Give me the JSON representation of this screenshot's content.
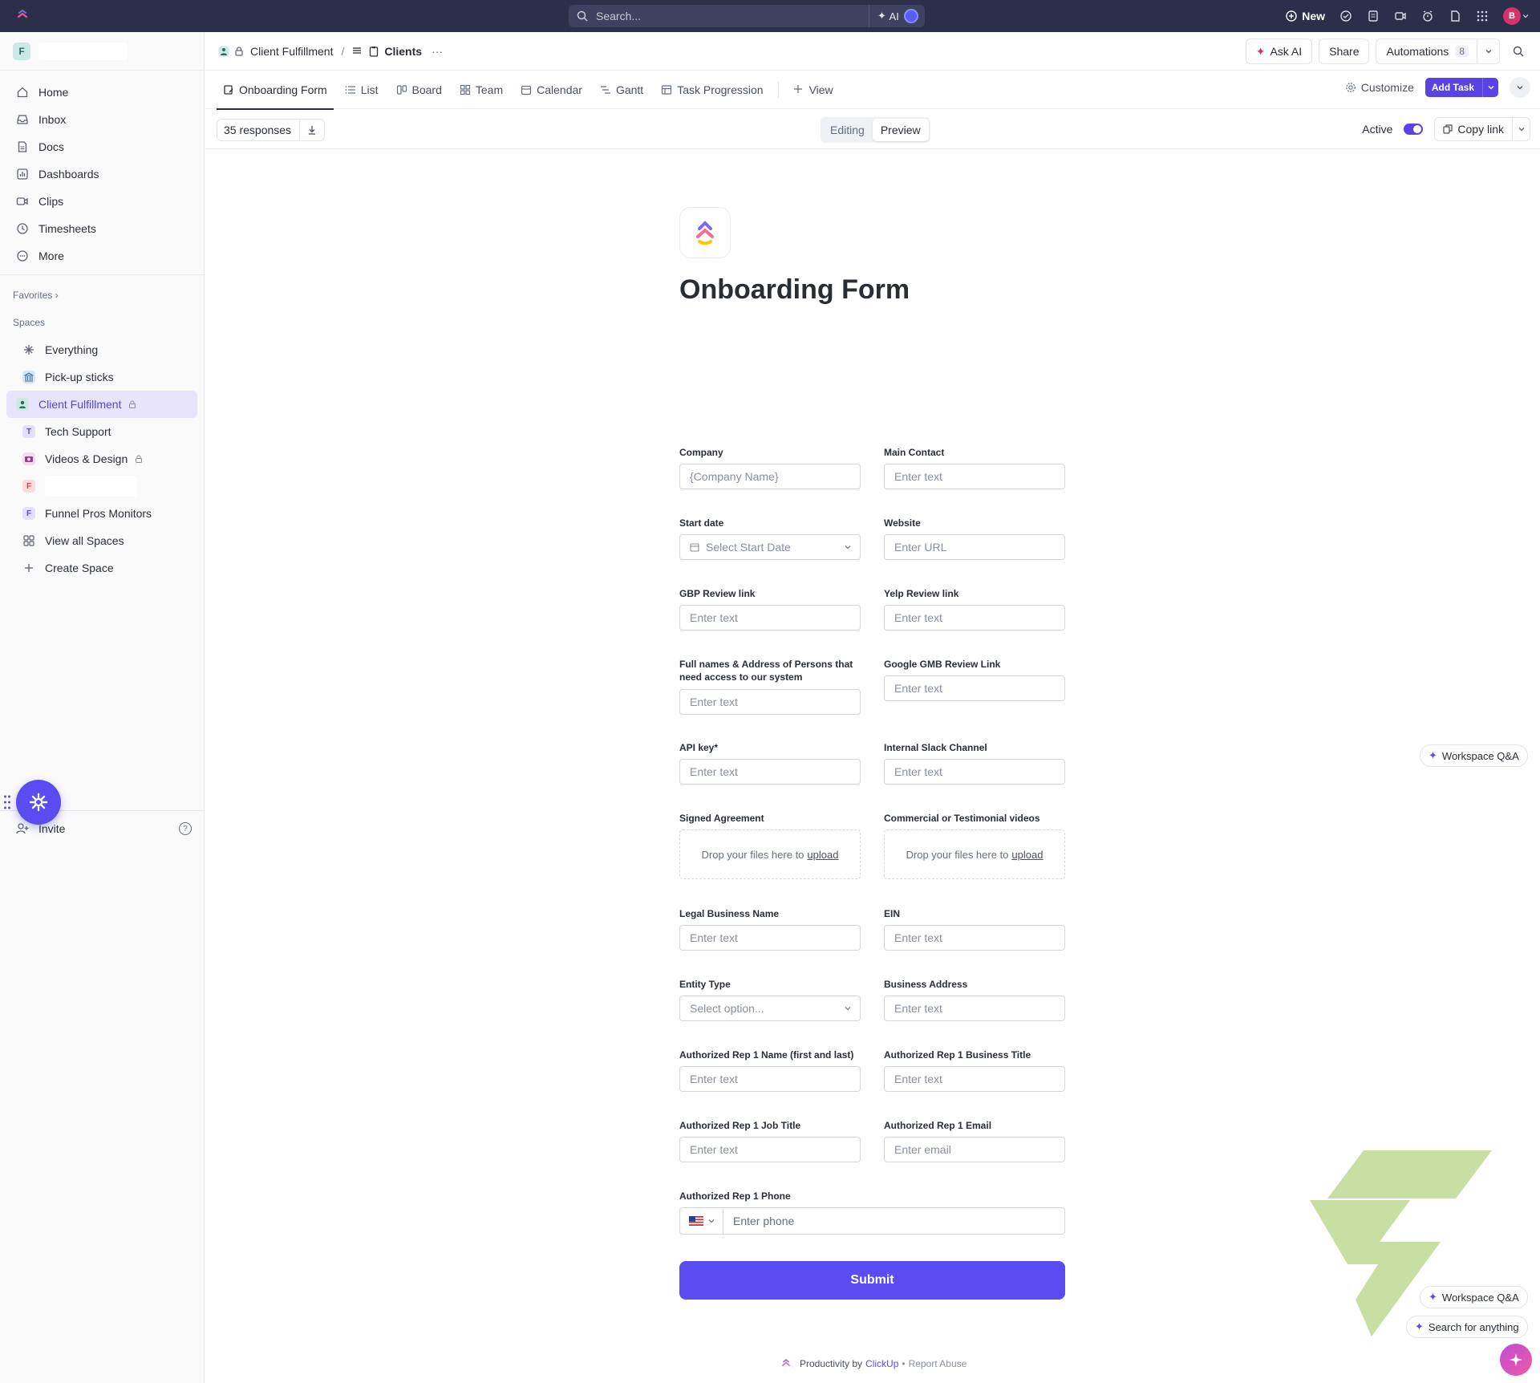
{
  "topbar": {
    "search_placeholder": "Search...",
    "ai_label": "AI",
    "new_label": "New",
    "avatar_initial": "B"
  },
  "sidebar": {
    "workspace_initial": "F",
    "nav": [
      {
        "label": "Home",
        "icon": "home-icon"
      },
      {
        "label": "Inbox",
        "icon": "inbox-icon"
      },
      {
        "label": "Docs",
        "icon": "docs-icon"
      },
      {
        "label": "Dashboards",
        "icon": "dashboards-icon"
      },
      {
        "label": "Clips",
        "icon": "clips-icon"
      },
      {
        "label": "Timesheets",
        "icon": "timesheets-icon"
      },
      {
        "label": "More",
        "icon": "more-icon"
      }
    ],
    "favorites_label": "Favorites",
    "spaces_label": "Spaces",
    "spaces": [
      {
        "label": "Everything",
        "icon": "everything-icon"
      },
      {
        "label": "Pick-up sticks",
        "icon": "bank-icon"
      },
      {
        "label": "Client Fulfillment",
        "icon": "person-icon",
        "locked": true,
        "active": true
      },
      {
        "label": "Tech Support",
        "badge": "T"
      },
      {
        "label": "Videos & Design",
        "icon": "camera-icon",
        "locked": true
      },
      {
        "label": "",
        "badge": "F"
      },
      {
        "label": "Funnel Pros Monitors",
        "badge": "F"
      },
      {
        "label": "View all Spaces",
        "icon": "grid-icon"
      },
      {
        "label": "Create Space",
        "icon": "plus-icon"
      }
    ],
    "invite_label": "Invite",
    "help_label": "?"
  },
  "breadcrumb": {
    "space": "Client Fulfillment",
    "separator": "/",
    "list": "Clients",
    "more": "···"
  },
  "header_actions": {
    "ask_ai": "Ask AI",
    "share": "Share",
    "automations": "Automations",
    "automations_count": "8"
  },
  "tabs": [
    {
      "label": "Onboarding Form",
      "icon": "form-icon",
      "active": true
    },
    {
      "label": "List",
      "icon": "list-icon"
    },
    {
      "label": "Board",
      "icon": "board-icon"
    },
    {
      "label": "Team",
      "icon": "team-icon"
    },
    {
      "label": "Calendar",
      "icon": "calendar-icon"
    },
    {
      "label": "Gantt",
      "icon": "gantt-icon"
    },
    {
      "label": "Task Progression",
      "icon": "table-icon"
    }
  ],
  "tabs_extra": {
    "view_label": "View",
    "customize_label": "Customize",
    "add_task_label": "Add Task"
  },
  "subbar": {
    "responses_label": "35 responses",
    "editing_label": "Editing",
    "preview_label": "Preview",
    "active_label": "Active",
    "copy_link_label": "Copy link"
  },
  "form": {
    "title": "Onboarding Form",
    "fields": {
      "company": {
        "label": "Company",
        "placeholder": "{Company Name}"
      },
      "main_contact": {
        "label": "Main Contact",
        "placeholder": "Enter text"
      },
      "start_date": {
        "label": "Start date",
        "placeholder": "Select Start Date"
      },
      "website": {
        "label": "Website",
        "placeholder": "Enter URL"
      },
      "gbp_review": {
        "label": "GBP Review link",
        "placeholder": "Enter text"
      },
      "yelp_review": {
        "label": "Yelp Review link",
        "placeholder": "Enter text"
      },
      "full_names": {
        "label": "Full names & Address of Persons that need access to our system",
        "placeholder": "Enter text"
      },
      "google_gmb": {
        "label": "Google GMB Review Link",
        "placeholder": "Enter text"
      },
      "api_key": {
        "label": "API key*",
        "placeholder": "Enter text"
      },
      "slack_channel": {
        "label": "Internal Slack Channel",
        "placeholder": "Enter text"
      },
      "signed_agreement": {
        "label": "Signed Agreement",
        "drop_text": "Drop your files here to",
        "upload": "upload"
      },
      "videos": {
        "label": "Commercial or Testimonial videos",
        "drop_text": "Drop your files here to",
        "upload": "upload"
      },
      "legal_name": {
        "label": "Legal Business Name",
        "placeholder": "Enter text"
      },
      "ein": {
        "label": "EIN",
        "placeholder": "Enter text"
      },
      "entity_type": {
        "label": "Entity Type",
        "placeholder": "Select option..."
      },
      "business_address": {
        "label": "Business Address",
        "placeholder": "Enter text"
      },
      "rep1_name": {
        "label": "Authorized Rep 1 Name (first and last)",
        "placeholder": "Enter text"
      },
      "rep1_business_title": {
        "label": "Authorized Rep 1 Business Title",
        "placeholder": "Enter text"
      },
      "rep1_job_title": {
        "label": "Authorized Rep 1 Job Title",
        "placeholder": "Enter text"
      },
      "rep1_email": {
        "label": "Authorized Rep 1 Email",
        "placeholder": "Enter email"
      },
      "rep1_phone": {
        "label": "Authorized Rep 1 Phone",
        "placeholder": "Enter phone"
      }
    },
    "submit_label": "Submit"
  },
  "footer": {
    "productivity": "Productivity by",
    "brand": "ClickUp",
    "dot": "•",
    "report": "Report Abuse"
  },
  "floating": {
    "workspace_qa": "Workspace Q&A",
    "search_anything": "Search for anything"
  },
  "colors": {
    "accent": "#5a4cf0",
    "topbar": "#2b2f4a",
    "active_space_bg": "#e8e4fb",
    "watermark_green": "#c8dfa4"
  }
}
